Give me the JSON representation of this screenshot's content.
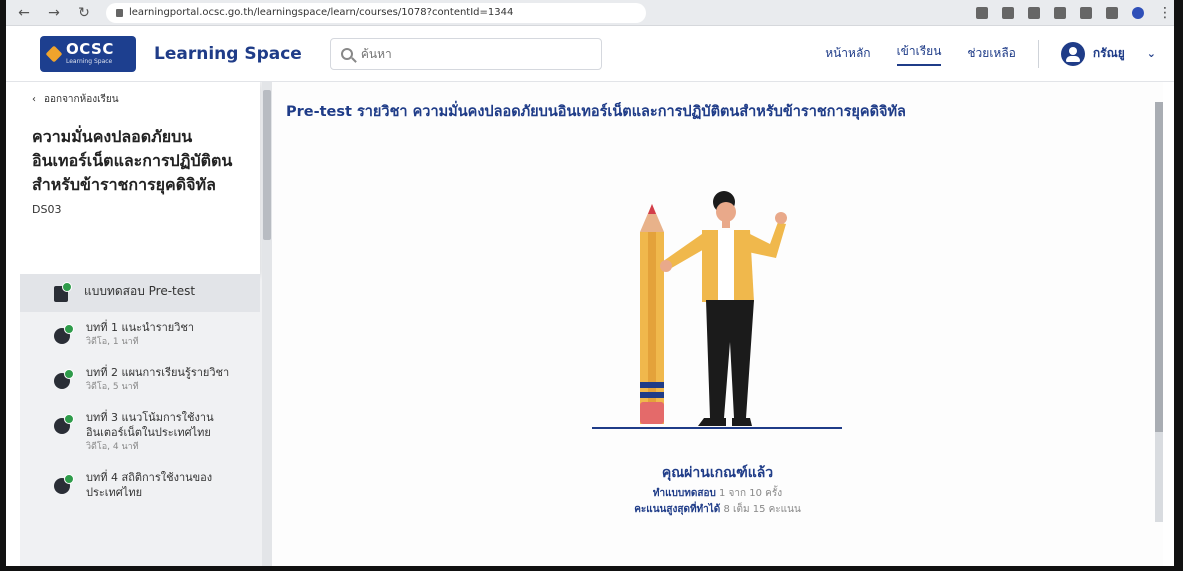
{
  "browser": {
    "url": "learningportal.ocsc.go.th/learningspace/learn/courses/1078?contentId=1344"
  },
  "header": {
    "logo_main": "OCSC",
    "logo_sub": "Learning Space",
    "app_name": "Learning Space",
    "search_placeholder": "ค้นหา",
    "nav": {
      "home": "หน้าหลัก",
      "learn": "เข้าเรียน",
      "help": "ช่วยเหลือ"
    },
    "user_name": "กรัณยู"
  },
  "sidebar": {
    "back_label": "ออกจากห้องเรียน",
    "course_title": "ความมั่นคงปลอดภัยบนอินเทอร์เน็ตและการปฏิบัติตนสำหรับข้าราชการยุคดิจิทัล",
    "course_code": "DS03",
    "lessons": [
      {
        "title": "แบบทดสอบ Pre-test",
        "meta": ""
      },
      {
        "title": "บทที่ 1 แนะนำรายวิชา",
        "meta": "วิดีโอ, 1 นาที"
      },
      {
        "title": "บทที่ 2 แผนการเรียนรู้รายวิชา",
        "meta": "วิดีโอ, 5 นาที"
      },
      {
        "title": "บทที่ 3 แนวโน้มการใช้งานอินเตอร์เน็ตในประเทศไทย",
        "meta": "วิดีโอ, 4 นาที"
      },
      {
        "title": "บทที่ 4 สถิติการใช้งานของประเทศไทย",
        "meta": ""
      }
    ]
  },
  "main": {
    "title": "Pre-test รายวิชา ความมั่นคงปลอดภัยบนอินเทอร์เน็ตและการปฏิบัติตนสำหรับข้าราชการยุคดิจิทัล",
    "result_title": "คุณผ่านเกณฑ์แล้ว",
    "attempts_label": "ทำแบบทดสอบ",
    "attempts_value": "1 จาก 10 ครั้ง",
    "best_score_label": "คะแนนสูงสุดที่ทำได้",
    "best_score_value": "8 เต็ม 15 คะแนน"
  },
  "colors": {
    "brand": "#1f3c88",
    "badge": "#2e9b4a"
  }
}
